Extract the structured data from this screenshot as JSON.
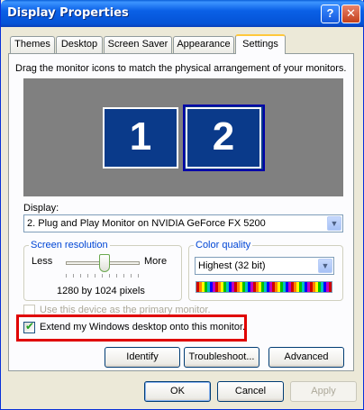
{
  "window": {
    "title": "Display Properties"
  },
  "titlebar": {
    "help_glyph": "?",
    "close_glyph": "✕"
  },
  "tabs": [
    {
      "label": "Themes"
    },
    {
      "label": "Desktop"
    },
    {
      "label": "Screen Saver"
    },
    {
      "label": "Appearance"
    },
    {
      "label": "Settings"
    }
  ],
  "settings": {
    "instruction": "Drag the monitor icons to match the physical arrangement of your monitors.",
    "monitors": [
      "1",
      "2"
    ],
    "display_label": "Display:",
    "display_value": "2. Plug and Play Monitor on NVIDIA GeForce FX 5200",
    "resolution": {
      "title": "Screen resolution",
      "less": "Less",
      "more": "More",
      "value": "1280 by 1024 pixels"
    },
    "color_quality": {
      "title": "Color quality",
      "value": "Highest (32 bit)"
    },
    "primary_checkbox": {
      "label": "Use this device as the primary monitor.",
      "checked": false
    },
    "extend_checkbox": {
      "label": "Extend my Windows desktop onto this monitor.",
      "checked": true
    },
    "buttons": {
      "identify": "Identify",
      "troubleshoot": "Troubleshoot...",
      "advanced": "Advanced"
    }
  },
  "footer": {
    "ok": "OK",
    "cancel": "Cancel",
    "apply": "Apply"
  },
  "colors": {
    "highlight_box": "#e00000",
    "titlebar": "#0a60e6",
    "monitor": "#0a3a8a"
  }
}
